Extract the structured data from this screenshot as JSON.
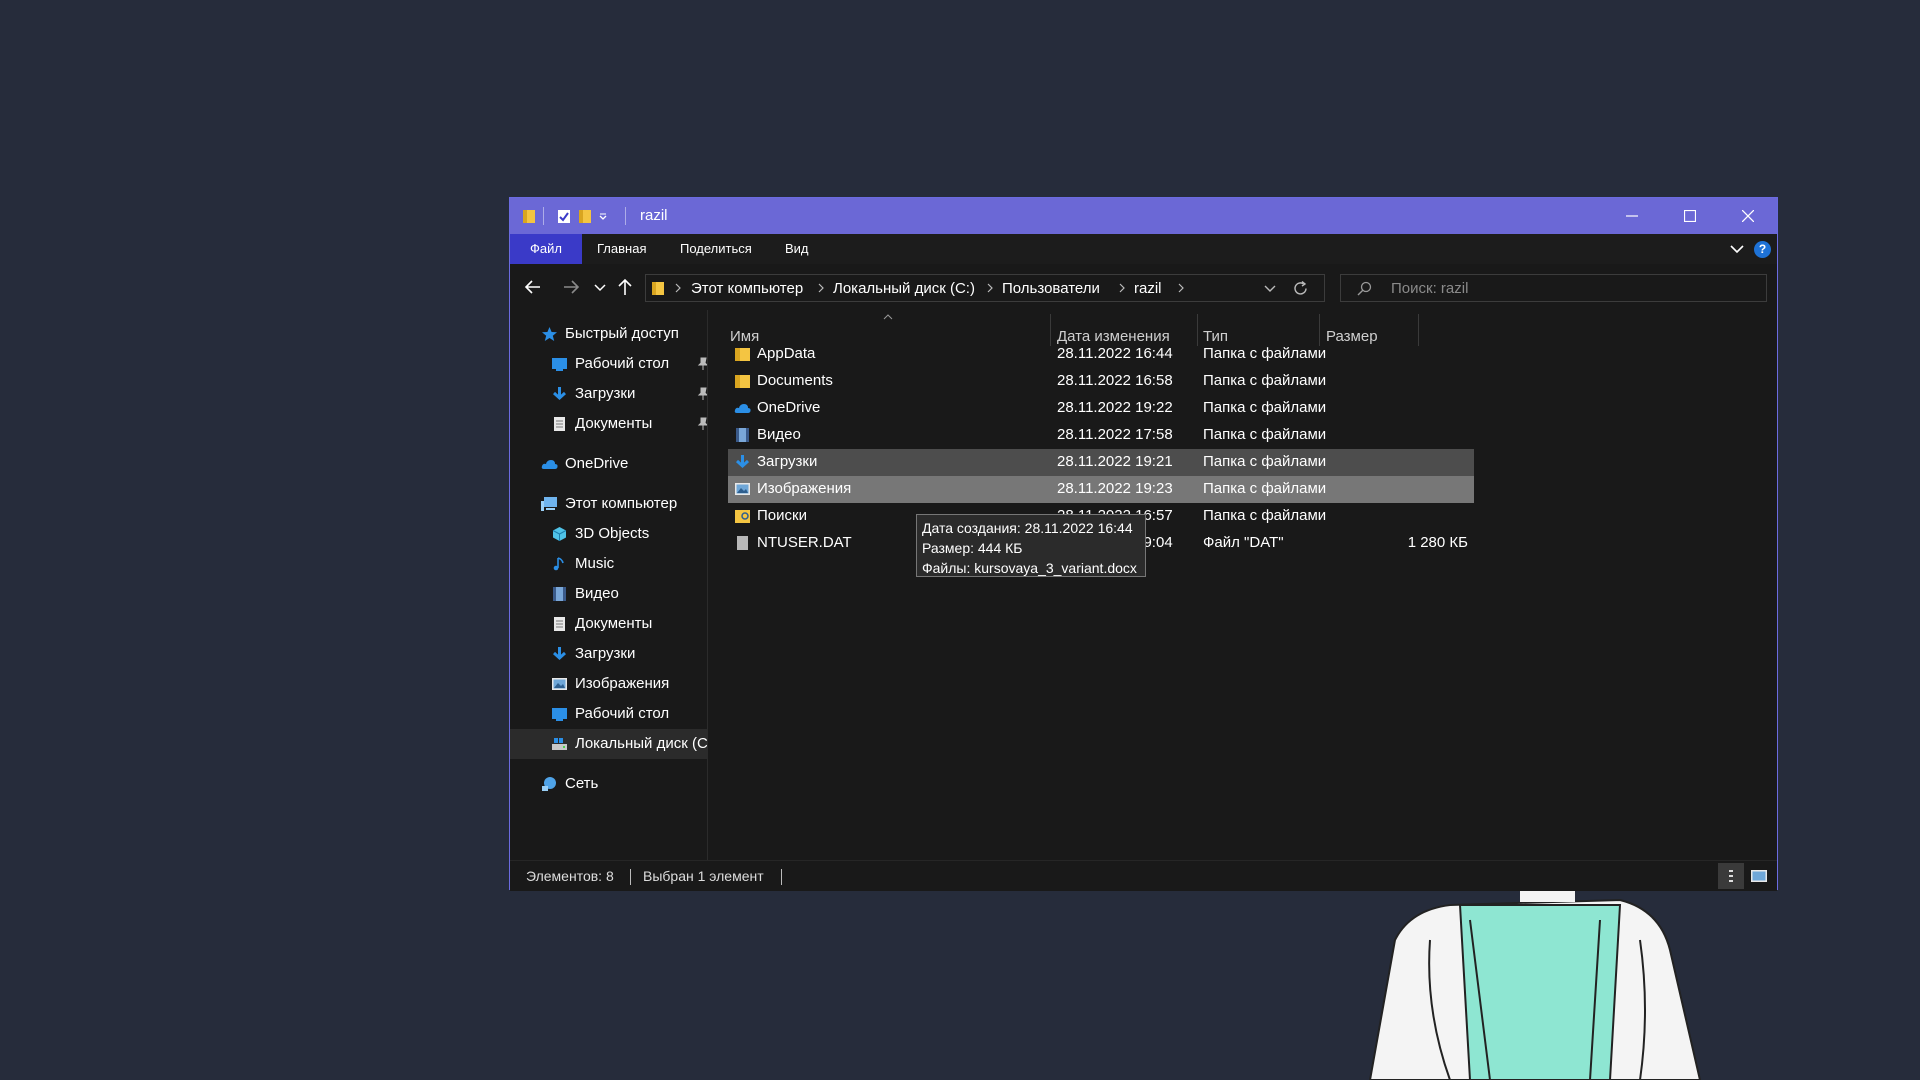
{
  "window": {
    "title": "razil",
    "accent": "#6b68d6",
    "controls": {
      "minimize": "minimize-icon",
      "maximize": "maximize-icon",
      "close": "close-icon"
    }
  },
  "ribbon": {
    "tabs": [
      "Файл",
      "Главная",
      "Поделиться",
      "Вид"
    ],
    "help_label": "?"
  },
  "address": {
    "crumbs": [
      "Этот компьютер",
      "Локальный диск (C:)",
      "Пользователи",
      "razil"
    ]
  },
  "search": {
    "placeholder": "Поиск: razil"
  },
  "sidebar": {
    "quick_access": "Быстрый доступ",
    "quick_items": [
      "Рабочий стол",
      "Загрузки",
      "Документы"
    ],
    "onedrive": "OneDrive",
    "this_pc": "Этот компьютер",
    "pc_items": [
      "3D Objects",
      "Music",
      "Видео",
      "Документы",
      "Загрузки",
      "Изображения",
      "Рабочий стол",
      "Локальный диск (C:)"
    ],
    "network": "Сеть"
  },
  "columns": {
    "name": "Имя",
    "date": "Дата изменения",
    "type": "Тип",
    "size": "Размер"
  },
  "files": [
    {
      "name": "AppData",
      "date": "28.11.2022 16:44",
      "type": "Папка с файлами",
      "size": "",
      "icon": "folder-icon"
    },
    {
      "name": "Documents",
      "date": "28.11.2022 16:58",
      "type": "Папка с файлами",
      "size": "",
      "icon": "folder-icon"
    },
    {
      "name": "OneDrive",
      "date": "28.11.2022 19:22",
      "type": "Папка с файлами",
      "size": "",
      "icon": "onedrive-icon"
    },
    {
      "name": "Видео",
      "date": "28.11.2022 17:58",
      "type": "Папка с файлами",
      "size": "",
      "icon": "video-folder-icon"
    },
    {
      "name": "Загрузки",
      "date": "28.11.2022 19:21",
      "type": "Папка с файлами",
      "size": "",
      "icon": "download-folder-icon"
    },
    {
      "name": "Изображения",
      "date": "28.11.2022 19:23",
      "type": "Папка с файлами",
      "size": "",
      "icon": "pictures-folder-icon"
    },
    {
      "name": "Поиски",
      "date": "28.11.2022 16:57",
      "type": "Папка с файлами",
      "size": "",
      "icon": "search-folder-icon"
    },
    {
      "name": "NTUSER.DAT",
      "date": "28.11.2022 19:04",
      "type": "Файл \"DAT\"",
      "size": "1 280 КБ",
      "icon": "file-icon"
    }
  ],
  "tooltip": {
    "line1": "Дата создания: 28.11.2022 16:44",
    "line2": "Размер: 444 КБ",
    "line3": "Файлы: kursovaya_3_variant.docx"
  },
  "status": {
    "count": "Элементов: 8",
    "selected": "Выбран 1 элемент"
  }
}
